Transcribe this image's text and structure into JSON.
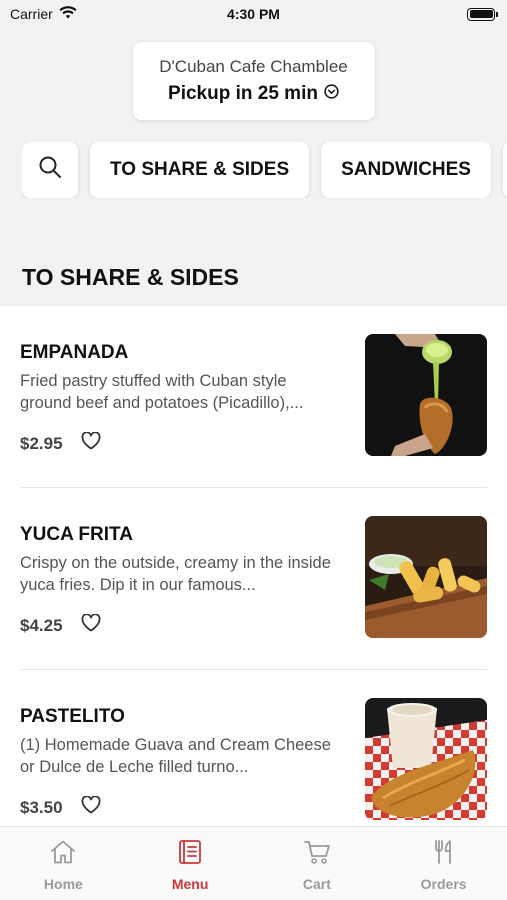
{
  "status_bar": {
    "carrier": "Carrier",
    "time": "4:30 PM"
  },
  "store": {
    "name": "D'Cuban Cafe Chamblee",
    "pickup": "Pickup in 25 min"
  },
  "categories": [
    {
      "label": "TO SHARE & SIDES"
    },
    {
      "label": "SANDWICHES"
    }
  ],
  "section_title": "TO SHARE & SIDES",
  "menu_items": [
    {
      "name": "EMPANADA",
      "description": "Fried pastry stuffed with Cuban style ground beef and potatoes (Picadillo),...",
      "price": "$2.95"
    },
    {
      "name": "YUCA FRITA",
      "description": "Crispy on the outside, creamy in the inside yuca fries. Dip it in our famous...",
      "price": "$4.25"
    },
    {
      "name": "PASTELITO",
      "description": "(1) Homemade Guava and Cream Cheese or Dulce de Leche filled turno...",
      "price": "$3.50"
    }
  ],
  "tab_bar": {
    "tabs": [
      {
        "label": "Home",
        "icon": "home-icon"
      },
      {
        "label": "Menu",
        "icon": "menu-icon"
      },
      {
        "label": "Cart",
        "icon": "cart-icon"
      },
      {
        "label": "Orders",
        "icon": "fork-knife-icon"
      }
    ],
    "active": "Menu"
  },
  "colors": {
    "accent": "#c8383b",
    "inactive": "#9a9a9a"
  }
}
